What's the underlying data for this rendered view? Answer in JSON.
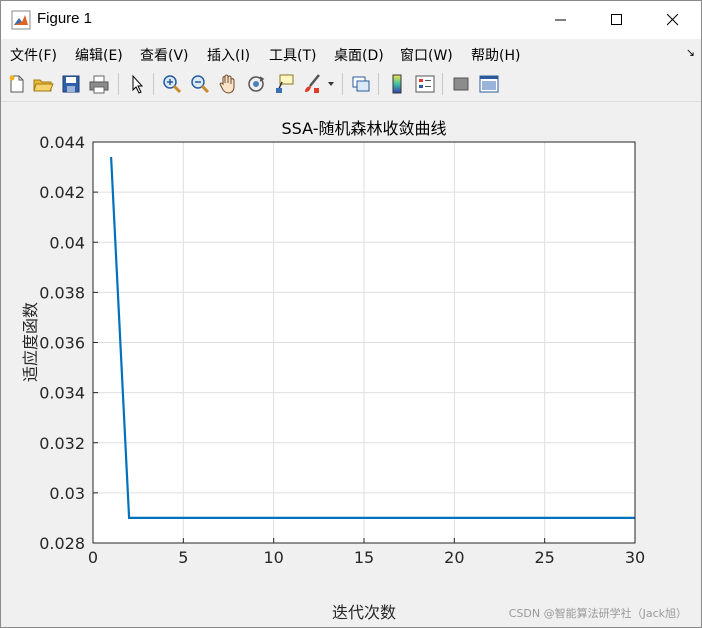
{
  "window": {
    "title": "Figure 1",
    "minimize_icon": "minimize-icon",
    "maximize_icon": "maximize-icon",
    "close_icon": "close-icon"
  },
  "menu": {
    "items": [
      "文件(F)",
      "编辑(E)",
      "查看(V)",
      "插入(I)",
      "工具(T)",
      "桌面(D)",
      "窗口(W)",
      "帮助(H)"
    ]
  },
  "toolbar": {
    "icons": [
      "new-figure-icon",
      "open-file-icon",
      "save-icon",
      "print-icon",
      "pointer-icon",
      "zoom-in-icon",
      "zoom-out-icon",
      "pan-hand-icon",
      "rotate-3d-icon",
      "data-cursor-icon",
      "brush-icon",
      "brush-dropdown-icon",
      "link-plot-icon",
      "colorbar-icon",
      "legend-icon",
      "hide-plot-tools-icon",
      "show-plot-tools-icon"
    ]
  },
  "watermark": "CSDN @智能算法研学社（Jack旭）",
  "chart_data": {
    "type": "line",
    "title": "SSA-随机森林收敛曲线",
    "xlabel": "迭代次数",
    "ylabel": "适应度函数",
    "xlim": [
      0,
      30
    ],
    "ylim": [
      0.028,
      0.044
    ],
    "xticks": [
      "0",
      "5",
      "10",
      "15",
      "20",
      "25",
      "30"
    ],
    "yticks": [
      "0.028",
      "0.03",
      "0.032",
      "0.034",
      "0.036",
      "0.038",
      "0.04",
      "0.042",
      "0.044"
    ],
    "grid": true,
    "line_color": "#0072BD",
    "series": [
      {
        "x": [
          1,
          2,
          3,
          4,
          5,
          6,
          7,
          8,
          9,
          10,
          11,
          12,
          13,
          14,
          15,
          16,
          17,
          18,
          19,
          20,
          21,
          22,
          23,
          24,
          25,
          26,
          27,
          28,
          29,
          30
        ],
        "values": [
          0.0434,
          0.029,
          0.029,
          0.029,
          0.029,
          0.029,
          0.029,
          0.029,
          0.029,
          0.029,
          0.029,
          0.029,
          0.029,
          0.029,
          0.029,
          0.029,
          0.029,
          0.029,
          0.029,
          0.029,
          0.029,
          0.029,
          0.029,
          0.029,
          0.029,
          0.029,
          0.029,
          0.029,
          0.029,
          0.029
        ]
      }
    ]
  }
}
